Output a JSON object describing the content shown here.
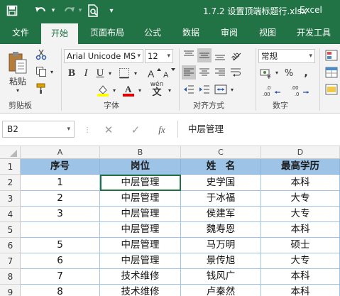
{
  "window": {
    "title": "1.7.2 设置顶端标题行.xlsx",
    "app": "Excel"
  },
  "tabs": [
    {
      "label": "文件",
      "active": false
    },
    {
      "label": "开始",
      "active": true
    },
    {
      "label": "页面布局",
      "active": false
    },
    {
      "label": "公式",
      "active": false
    },
    {
      "label": "数据",
      "active": false
    },
    {
      "label": "审阅",
      "active": false
    },
    {
      "label": "视图",
      "active": false
    },
    {
      "label": "开发工具",
      "active": false
    }
  ],
  "ribbon": {
    "paste_label": "粘贴",
    "font_name": "Arial Unicode MS",
    "font_size": "12",
    "bold": "B",
    "italic": "I",
    "underline": "U",
    "phonetic": "wén",
    "number_format": "常规",
    "groups": {
      "clipboard": "剪贴板",
      "font": "字体",
      "alignment": "对齐方式",
      "number": "数字"
    }
  },
  "formula_bar": {
    "name_box": "B2",
    "content": "中层管理"
  },
  "columns": [
    "A",
    "B",
    "C",
    "D"
  ],
  "rows": [
    "1",
    "2",
    "3",
    "4",
    "5",
    "6",
    "7",
    "8",
    "9"
  ],
  "table": {
    "headers": [
      "序号",
      "岗位",
      "姓　名",
      "最高学历"
    ],
    "rows": [
      [
        "1",
        "中层管理",
        "史学国",
        "本科"
      ],
      [
        "2",
        "中层管理",
        "于冰福",
        "大专"
      ],
      [
        "3",
        "中层管理",
        "侯建军",
        "大专"
      ],
      [
        "",
        "中层管理",
        "魏寿恩",
        "本科"
      ],
      [
        "5",
        "中层管理",
        "马万明",
        "硕士"
      ],
      [
        "6",
        "中层管理",
        "景传旭",
        "大专"
      ],
      [
        "7",
        "技术维修",
        "钱风广",
        "本科"
      ],
      [
        "8",
        "技术维修",
        "卢秦然",
        "本科"
      ]
    ]
  },
  "colors": {
    "accent": "#217346",
    "header_fill": "#9dc3e6",
    "font_color_swatch": "#e00000",
    "fill_color_swatch": "#ffff00"
  }
}
